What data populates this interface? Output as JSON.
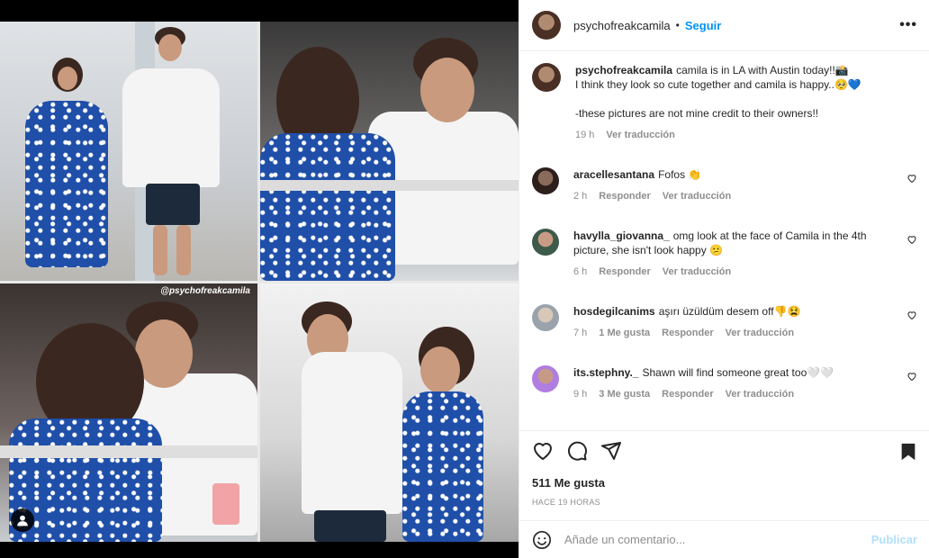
{
  "post": {
    "username": "psychofreakcamila",
    "follow_label": "Seguir",
    "more_label": "•••",
    "watermark": "@psychofreakcamila"
  },
  "caption": {
    "username": "psychofreakcamila",
    "line1": "camila is in LA with Austin today!!📸",
    "line2": "I think they look so cute together and camila is happy..🥺💙",
    "line3": "-these pictures are not mine credit to their owners!!",
    "time": "19 h",
    "translate": "Ver traducción"
  },
  "comments": [
    {
      "username": "aracellesantana",
      "text": "Fofos 👏",
      "time": "2 h",
      "likes": "",
      "reply": "Responder",
      "translate": "Ver traducción"
    },
    {
      "username": "havylla_giovanna_",
      "text": "omg look at the face of Camila in the 4th picture, she isn't look happy 😕",
      "time": "6 h",
      "likes": "",
      "reply": "Responder",
      "translate": "Ver traducción"
    },
    {
      "username": "hosdegilcanims",
      "text": "aşırı üzüldüm desem off👎😫",
      "time": "7 h",
      "likes": "1 Me gusta",
      "reply": "Responder",
      "translate": "Ver traducción"
    },
    {
      "username": "its.stephny._",
      "text": "Shawn will find someone great too🤍🤍",
      "time": "9 h",
      "likes": "3 Me gusta",
      "reply": "Responder",
      "translate": "Ver traducción"
    }
  ],
  "stats": {
    "likes": "511 Me gusta",
    "ago": "HACE 19 HORAS"
  },
  "composer": {
    "placeholder": "Añade un comentario...",
    "publish": "Publicar"
  },
  "icons": [
    "heart-icon",
    "comment-icon",
    "share-icon",
    "bookmark-icon",
    "emoji-icon",
    "user-tag-icon",
    "more-icon"
  ]
}
